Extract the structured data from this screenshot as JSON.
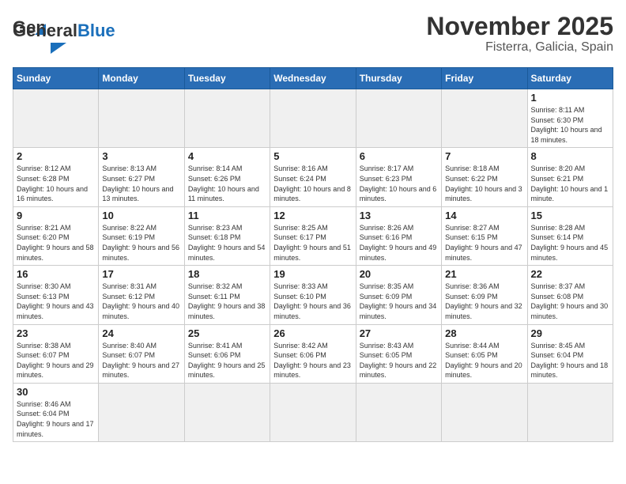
{
  "header": {
    "logo_general": "General",
    "logo_blue": "Blue",
    "month_title": "November 2025",
    "location": "Fisterra, Galicia, Spain"
  },
  "days_of_week": [
    "Sunday",
    "Monday",
    "Tuesday",
    "Wednesday",
    "Thursday",
    "Friday",
    "Saturday"
  ],
  "weeks": [
    [
      {
        "day": "",
        "info": ""
      },
      {
        "day": "",
        "info": ""
      },
      {
        "day": "",
        "info": ""
      },
      {
        "day": "",
        "info": ""
      },
      {
        "day": "",
        "info": ""
      },
      {
        "day": "",
        "info": ""
      },
      {
        "day": "1",
        "info": "Sunrise: 8:11 AM\nSunset: 6:30 PM\nDaylight: 10 hours and 18 minutes."
      }
    ],
    [
      {
        "day": "2",
        "info": "Sunrise: 8:12 AM\nSunset: 6:28 PM\nDaylight: 10 hours and 16 minutes."
      },
      {
        "day": "3",
        "info": "Sunrise: 8:13 AM\nSunset: 6:27 PM\nDaylight: 10 hours and 13 minutes."
      },
      {
        "day": "4",
        "info": "Sunrise: 8:14 AM\nSunset: 6:26 PM\nDaylight: 10 hours and 11 minutes."
      },
      {
        "day": "5",
        "info": "Sunrise: 8:16 AM\nSunset: 6:24 PM\nDaylight: 10 hours and 8 minutes."
      },
      {
        "day": "6",
        "info": "Sunrise: 8:17 AM\nSunset: 6:23 PM\nDaylight: 10 hours and 6 minutes."
      },
      {
        "day": "7",
        "info": "Sunrise: 8:18 AM\nSunset: 6:22 PM\nDaylight: 10 hours and 3 minutes."
      },
      {
        "day": "8",
        "info": "Sunrise: 8:20 AM\nSunset: 6:21 PM\nDaylight: 10 hours and 1 minute."
      }
    ],
    [
      {
        "day": "9",
        "info": "Sunrise: 8:21 AM\nSunset: 6:20 PM\nDaylight: 9 hours and 58 minutes."
      },
      {
        "day": "10",
        "info": "Sunrise: 8:22 AM\nSunset: 6:19 PM\nDaylight: 9 hours and 56 minutes."
      },
      {
        "day": "11",
        "info": "Sunrise: 8:23 AM\nSunset: 6:18 PM\nDaylight: 9 hours and 54 minutes."
      },
      {
        "day": "12",
        "info": "Sunrise: 8:25 AM\nSunset: 6:17 PM\nDaylight: 9 hours and 51 minutes."
      },
      {
        "day": "13",
        "info": "Sunrise: 8:26 AM\nSunset: 6:16 PM\nDaylight: 9 hours and 49 minutes."
      },
      {
        "day": "14",
        "info": "Sunrise: 8:27 AM\nSunset: 6:15 PM\nDaylight: 9 hours and 47 minutes."
      },
      {
        "day": "15",
        "info": "Sunrise: 8:28 AM\nSunset: 6:14 PM\nDaylight: 9 hours and 45 minutes."
      }
    ],
    [
      {
        "day": "16",
        "info": "Sunrise: 8:30 AM\nSunset: 6:13 PM\nDaylight: 9 hours and 43 minutes."
      },
      {
        "day": "17",
        "info": "Sunrise: 8:31 AM\nSunset: 6:12 PM\nDaylight: 9 hours and 40 minutes."
      },
      {
        "day": "18",
        "info": "Sunrise: 8:32 AM\nSunset: 6:11 PM\nDaylight: 9 hours and 38 minutes."
      },
      {
        "day": "19",
        "info": "Sunrise: 8:33 AM\nSunset: 6:10 PM\nDaylight: 9 hours and 36 minutes."
      },
      {
        "day": "20",
        "info": "Sunrise: 8:35 AM\nSunset: 6:09 PM\nDaylight: 9 hours and 34 minutes."
      },
      {
        "day": "21",
        "info": "Sunrise: 8:36 AM\nSunset: 6:09 PM\nDaylight: 9 hours and 32 minutes."
      },
      {
        "day": "22",
        "info": "Sunrise: 8:37 AM\nSunset: 6:08 PM\nDaylight: 9 hours and 30 minutes."
      }
    ],
    [
      {
        "day": "23",
        "info": "Sunrise: 8:38 AM\nSunset: 6:07 PM\nDaylight: 9 hours and 29 minutes."
      },
      {
        "day": "24",
        "info": "Sunrise: 8:40 AM\nSunset: 6:07 PM\nDaylight: 9 hours and 27 minutes."
      },
      {
        "day": "25",
        "info": "Sunrise: 8:41 AM\nSunset: 6:06 PM\nDaylight: 9 hours and 25 minutes."
      },
      {
        "day": "26",
        "info": "Sunrise: 8:42 AM\nSunset: 6:06 PM\nDaylight: 9 hours and 23 minutes."
      },
      {
        "day": "27",
        "info": "Sunrise: 8:43 AM\nSunset: 6:05 PM\nDaylight: 9 hours and 22 minutes."
      },
      {
        "day": "28",
        "info": "Sunrise: 8:44 AM\nSunset: 6:05 PM\nDaylight: 9 hours and 20 minutes."
      },
      {
        "day": "29",
        "info": "Sunrise: 8:45 AM\nSunset: 6:04 PM\nDaylight: 9 hours and 18 minutes."
      }
    ],
    [
      {
        "day": "30",
        "info": "Sunrise: 8:46 AM\nSunset: 6:04 PM\nDaylight: 9 hours and 17 minutes."
      },
      {
        "day": "",
        "info": ""
      },
      {
        "day": "",
        "info": ""
      },
      {
        "day": "",
        "info": ""
      },
      {
        "day": "",
        "info": ""
      },
      {
        "day": "",
        "info": ""
      },
      {
        "day": "",
        "info": ""
      }
    ]
  ]
}
